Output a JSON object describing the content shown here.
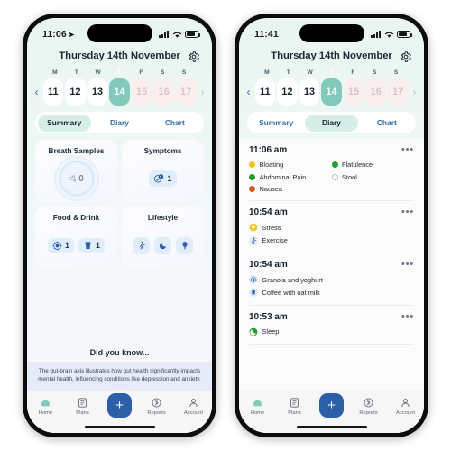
{
  "phones": [
    {
      "id": "summary-screen",
      "status": {
        "time": "11:06",
        "location_icon": "location-arrow-icon",
        "signal_icon": "cellular-signal-icon",
        "wifi_icon": "wifi-icon",
        "battery_icon": "battery-icon"
      },
      "header": {
        "title": "Thursday 14th November",
        "settings_icon": "gear-icon"
      },
      "calendar": {
        "prev_icon": "chevron-left-icon",
        "next_icon": "chevron-right-icon",
        "weekdays": [
          "M",
          "T",
          "W",
          "T",
          "F",
          "S",
          "S"
        ],
        "today_index": 3,
        "dates": [
          {
            "day": "11",
            "state": "past"
          },
          {
            "day": "12",
            "state": "past"
          },
          {
            "day": "13",
            "state": "past"
          },
          {
            "day": "14",
            "state": "selected"
          },
          {
            "day": "15",
            "state": "future"
          },
          {
            "day": "16",
            "state": "future"
          },
          {
            "day": "17",
            "state": "future"
          }
        ]
      },
      "tabs": [
        {
          "label": "Summary",
          "active": true
        },
        {
          "label": "Diary",
          "active": false
        },
        {
          "label": "Chart",
          "active": false
        }
      ],
      "cards": [
        {
          "title": "Breath Samples",
          "type": "gauge",
          "value": "0",
          "icon": "breath-wave-icon"
        },
        {
          "title": "Symptoms",
          "type": "pill",
          "items": [
            {
              "icon": "symptom-face-icon",
              "count": "1"
            }
          ]
        },
        {
          "title": "Food & Drink",
          "type": "pill",
          "items": [
            {
              "icon": "meal-icon",
              "count": "1"
            },
            {
              "icon": "drink-cup-icon",
              "count": "1"
            }
          ]
        },
        {
          "title": "Lifestyle",
          "type": "icons",
          "items": [
            {
              "icon": "walking-icon"
            },
            {
              "icon": "moon-icon"
            },
            {
              "icon": "bulb-icon"
            }
          ]
        }
      ],
      "did_you_know": {
        "title": "Did you know...",
        "body": "The gut-brain axis illustrates how gut health significantly impacts mental health, influencing conditions like depression and anxiety."
      },
      "nav": [
        {
          "label": "Home",
          "icon": "home-icon",
          "active": true
        },
        {
          "label": "Plans",
          "icon": "plans-icon",
          "active": false
        },
        {
          "label": "",
          "icon": "add-icon",
          "fab": true
        },
        {
          "label": "Reports",
          "icon": "reports-icon",
          "active": false
        },
        {
          "label": "Account",
          "icon": "account-icon",
          "active": false
        }
      ]
    },
    {
      "id": "diary-screen",
      "status": {
        "time": "11:41",
        "location_icon": "",
        "signal_icon": "cellular-signal-icon",
        "wifi_icon": "wifi-icon",
        "battery_icon": "battery-icon"
      },
      "header": {
        "title": "Thursday 14th November",
        "settings_icon": "gear-icon"
      },
      "calendar": {
        "prev_icon": "chevron-left-icon",
        "next_icon": "chevron-right-icon",
        "weekdays": [
          "M",
          "T",
          "W",
          "T",
          "F",
          "S",
          "S"
        ],
        "today_index": 3,
        "dates": [
          {
            "day": "11",
            "state": "past"
          },
          {
            "day": "12",
            "state": "past"
          },
          {
            "day": "13",
            "state": "past"
          },
          {
            "day": "14",
            "state": "selected"
          },
          {
            "day": "15",
            "state": "future"
          },
          {
            "day": "16",
            "state": "future"
          },
          {
            "day": "17",
            "state": "future"
          }
        ]
      },
      "tabs": [
        {
          "label": "Summary",
          "active": false
        },
        {
          "label": "Diary",
          "active": true
        },
        {
          "label": "Chart",
          "active": false
        }
      ],
      "entries": [
        {
          "time": "11:06 am",
          "menu_icon": "more-options-icon",
          "items": [
            {
              "label": "Bloating",
              "marker": "dot",
              "color": "#f5c518"
            },
            {
              "label": "Flatulence",
              "marker": "dot",
              "color": "#1f9d2f"
            },
            {
              "label": "Abdominal Pain",
              "marker": "dot",
              "color": "#1f9d2f"
            },
            {
              "label": "Stool",
              "marker": "hollow",
              "color": "#ffffff"
            },
            {
              "label": "Nausea",
              "marker": "dot",
              "color": "#d4581c"
            }
          ]
        },
        {
          "time": "10:54 am",
          "menu_icon": "more-options-icon",
          "items": [
            {
              "label": "Stress",
              "marker": "bulb-icon",
              "color": "#f5c518",
              "full": true
            },
            {
              "label": "Exercise",
              "marker": "walking-icon",
              "color": "#2b5fa8",
              "full": true
            }
          ]
        },
        {
          "time": "10:54 am",
          "menu_icon": "more-options-icon",
          "items": [
            {
              "label": "Granola and yoghurt",
              "marker": "meal-icon",
              "color": "#2b5fa8",
              "full": true
            },
            {
              "label": "Coffee with oat milk",
              "marker": "drink-cup-icon",
              "color": "#2b5fa8",
              "full": true
            }
          ]
        },
        {
          "time": "10:53 am",
          "menu_icon": "more-options-icon",
          "items": [
            {
              "label": "Sleep",
              "marker": "moon-icon",
              "color": "#1f9d2f",
              "full": true
            }
          ]
        }
      ],
      "nav": [
        {
          "label": "Home",
          "icon": "home-icon",
          "active": true
        },
        {
          "label": "Plans",
          "icon": "plans-icon",
          "active": false
        },
        {
          "label": "",
          "icon": "add-icon",
          "fab": true
        },
        {
          "label": "Reports",
          "icon": "reports-icon",
          "active": false
        },
        {
          "label": "Account",
          "icon": "account-icon",
          "active": false
        }
      ]
    }
  ],
  "theme": {
    "accent_teal": "#82c9bb",
    "accent_blue": "#2b5fa8",
    "today_marker": "#cdb79e",
    "future_date": "#fbeeee",
    "screen_bg": "#eef7f4"
  }
}
